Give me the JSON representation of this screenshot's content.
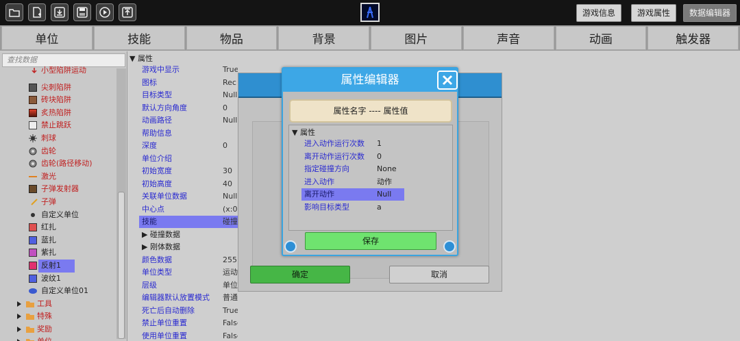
{
  "toolbar": {
    "icons": [
      "folder-open-icon",
      "new-file-icon",
      "download-icon",
      "save-disk-icon",
      "play-icon",
      "upload-icon"
    ],
    "right_buttons": [
      {
        "label": "游戏信息",
        "active": false
      },
      {
        "label": "游戏属性",
        "active": false
      },
      {
        "label": "数据编辑器",
        "active": true
      }
    ]
  },
  "tabs": [
    "单位",
    "技能",
    "物品",
    "背景",
    "图片",
    "声音",
    "动画",
    "触发器"
  ],
  "left_panel": {
    "search_placeholder": "查找数据",
    "items": [
      {
        "label": "小型陷阱运动",
        "color": "#c02020",
        "icon": "red-arrow-icon"
      },
      {
        "label": "尖刺陷阱",
        "color": "#c02020",
        "icon": "spike-trap-icon"
      },
      {
        "label": "砖块陷阱",
        "color": "#c02020",
        "icon": "brick-trap-icon"
      },
      {
        "label": "炙热陷阱",
        "color": "#c02020",
        "icon": "fire-trap-icon"
      },
      {
        "label": "禁止跳跃",
        "color": "#c02020",
        "icon": "no-jump-icon"
      },
      {
        "label": "刺球",
        "color": "#c02020",
        "icon": "spike-ball-icon"
      },
      {
        "label": "齿轮",
        "color": "#c02020",
        "icon": "gear-icon"
      },
      {
        "label": "齿轮(路径移动)",
        "color": "#c02020",
        "icon": "gear-path-icon"
      },
      {
        "label": "激光",
        "color": "#c02020",
        "icon": "laser-icon"
      },
      {
        "label": "子弹发射器",
        "color": "#c02020",
        "icon": "bullet-launcher-icon"
      },
      {
        "label": "子弹",
        "color": "#c02020",
        "icon": "bullet-icon"
      },
      {
        "label": "自定义单位",
        "color": "#222222",
        "icon": "custom-unit-icon"
      },
      {
        "label": "红扎",
        "color": "#222222",
        "icon": "red-square-icon"
      },
      {
        "label": "蓝扎",
        "color": "#222222",
        "icon": "blue-square-icon"
      },
      {
        "label": "紫扎",
        "color": "#222222",
        "icon": "purple-square-icon"
      },
      {
        "label": "反射1",
        "color": "#222222",
        "icon": "reflect-icon"
      },
      {
        "label": "波纹1",
        "color": "#222222",
        "icon": "wave-icon"
      },
      {
        "label": "自定义单位01",
        "color": "#222222",
        "icon": "custom-unit-blue-icon"
      }
    ],
    "folders": [
      {
        "label": "工具"
      },
      {
        "label": "特殊"
      },
      {
        "label": "奖励"
      },
      {
        "label": "单位"
      }
    ]
  },
  "props": {
    "header": "属性",
    "rows": [
      {
        "k": "游戏中显示",
        "v": "True"
      },
      {
        "k": "图标",
        "v": "Rec"
      },
      {
        "k": "目标类型",
        "v": "Null"
      },
      {
        "k": "默认方向角度",
        "v": "0"
      },
      {
        "k": "动画路径",
        "v": "Null"
      },
      {
        "k": "帮助信息",
        "v": ""
      },
      {
        "k": "深度",
        "v": "0"
      },
      {
        "k": "单位介绍",
        "v": ""
      },
      {
        "k": "初始宽度",
        "v": "30"
      },
      {
        "k": "初始高度",
        "v": "40"
      },
      {
        "k": "关联单位数据",
        "v": "Null"
      },
      {
        "k": "中心点",
        "v": "(x:0,"
      },
      {
        "k": "技能",
        "v": "碰撞",
        "sel": true
      },
      {
        "k": "碰撞数据",
        "v": "",
        "group": true
      },
      {
        "k": "刚体数据",
        "v": "",
        "group": true
      },
      {
        "k": "颜色数据",
        "v": "255"
      },
      {
        "k": "单位类型",
        "v": "运动"
      },
      {
        "k": "层级",
        "v": "单位"
      },
      {
        "k": "编辑器默认放置模式",
        "v": "普通"
      },
      {
        "k": "死亡后自动删除",
        "v": "True"
      },
      {
        "k": "禁止单位重置",
        "v": "False"
      },
      {
        "k": "使用单位重置",
        "v": "False"
      }
    ]
  },
  "bg_dialog": {
    "ok_label": "确定",
    "cancel_label": "取消"
  },
  "modal": {
    "title": "属性编辑器",
    "header": "属性名字 ---- 属性值",
    "section": "属性",
    "rows": [
      {
        "k": "进入动作运行次数",
        "v": "1"
      },
      {
        "k": "离开动作运行次数",
        "v": "0"
      },
      {
        "k": "指定碰撞方向",
        "v": "None"
      },
      {
        "k": "进入动作",
        "v": "动作"
      },
      {
        "k": "离开动作",
        "v": "Null",
        "sel": true
      },
      {
        "k": "影响目标类型",
        "v": "a"
      }
    ],
    "save_label": "保存"
  }
}
